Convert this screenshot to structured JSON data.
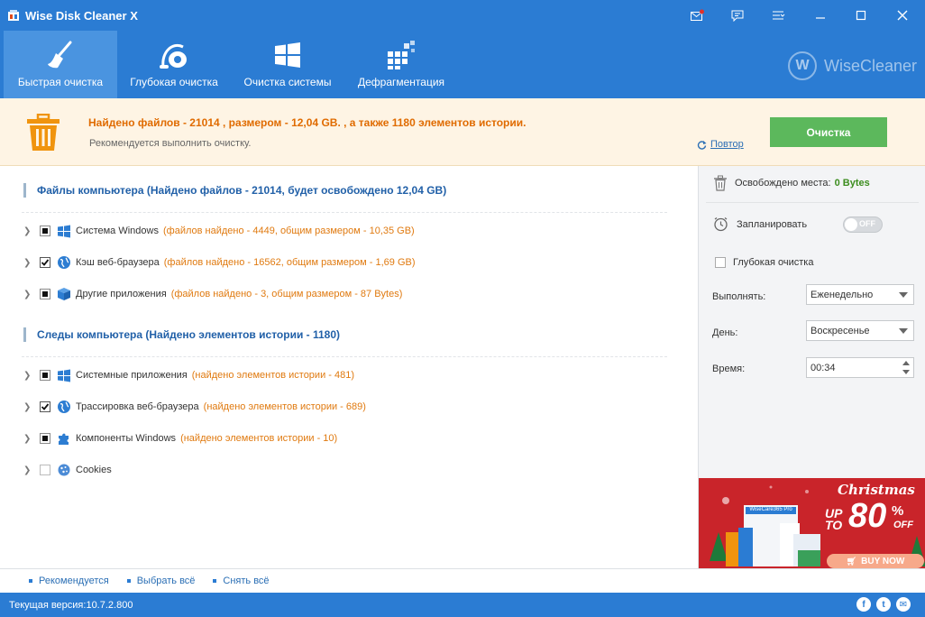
{
  "window": {
    "title": "Wise Disk Cleaner X"
  },
  "tabs": [
    {
      "label": "Быстрая очистка",
      "icon": "broom-icon",
      "active": true
    },
    {
      "label": "Глубокая очистка",
      "icon": "vacuum-cleaner-icon",
      "active": false
    },
    {
      "label": "Очистка системы",
      "icon": "windows-icon",
      "active": false
    },
    {
      "label": "Дефрагментация",
      "icon": "defrag-blocks-icon",
      "active": false
    }
  ],
  "brand": {
    "logo_letter": "W",
    "name": "WiseCleaner"
  },
  "summary": {
    "main": "Найдено файлов - 21014 , размером - 12,04 GB. , а также 1180 элементов истории.",
    "sub": "Рекомендуется выполнить очистку.",
    "retry_label": "Повтор",
    "clean_label": "Очистка"
  },
  "sections": {
    "files": {
      "title": "Файлы компьютера  (Найдено файлов - 21014, будет освобождено 12,04 GB)",
      "items": [
        {
          "name": "Система Windows",
          "info": "(файлов найдено - 4449, общим размером - 10,35 GB)",
          "state": "partial",
          "icon": "windows-icon"
        },
        {
          "name": "Кэш веб-браузера",
          "info": "(файлов найдено - 16562, общим размером - 1,69 GB)",
          "state": "checked",
          "icon": "globe-icon"
        },
        {
          "name": "Другие приложения",
          "info": "(файлов найдено - 3, общим размером - 87 Bytes)",
          "state": "partial",
          "icon": "box-icon"
        }
      ]
    },
    "traces": {
      "title": "Следы компьютера  (Найдено элементов истории - 1180)",
      "items": [
        {
          "name": "Системные приложения",
          "info": "(найдено элементов истории - 481)",
          "state": "partial",
          "icon": "windows-icon"
        },
        {
          "name": "Трассировка веб-браузера",
          "info": "(найдено элементов истории - 689)",
          "state": "checked",
          "icon": "globe-icon"
        },
        {
          "name": "Компоненты Windows",
          "info": "(найдено элементов истории - 10)",
          "state": "partial",
          "icon": "puzzle-icon"
        },
        {
          "name": "Cookies",
          "info": "",
          "state": "empty",
          "icon": "cookie-icon"
        }
      ]
    }
  },
  "right": {
    "freed_label": "Освобождено места:",
    "freed_value": "0 Bytes",
    "schedule_label": "Запланировать",
    "toggle_text": "OFF",
    "deep_label": "Глубокая очистка",
    "run_label": "Выполнять:",
    "run_value": "Еженедельно",
    "day_label": "День:",
    "day_value": "Воскресенье",
    "time_label": "Время:",
    "time_value": "00:34"
  },
  "promo": {
    "title": "Christmas",
    "up_to": "UP TO",
    "percent": "80",
    "percent_sign": "%",
    "off": "OFF",
    "product": "WiseCare365 Pro",
    "buy_label": "BUY NOW"
  },
  "bottom_links": [
    "Рекомендуется",
    "Выбрать всё",
    "Снять всё"
  ],
  "status": {
    "version": "Текущая версия:10.7.2.800"
  },
  "social": [
    "facebook-icon",
    "twitter-icon",
    "email-icon"
  ],
  "colors": {
    "header_blue": "#2b7cd3",
    "accent_orange": "#e06b00",
    "clean_green": "#5cb85c"
  }
}
